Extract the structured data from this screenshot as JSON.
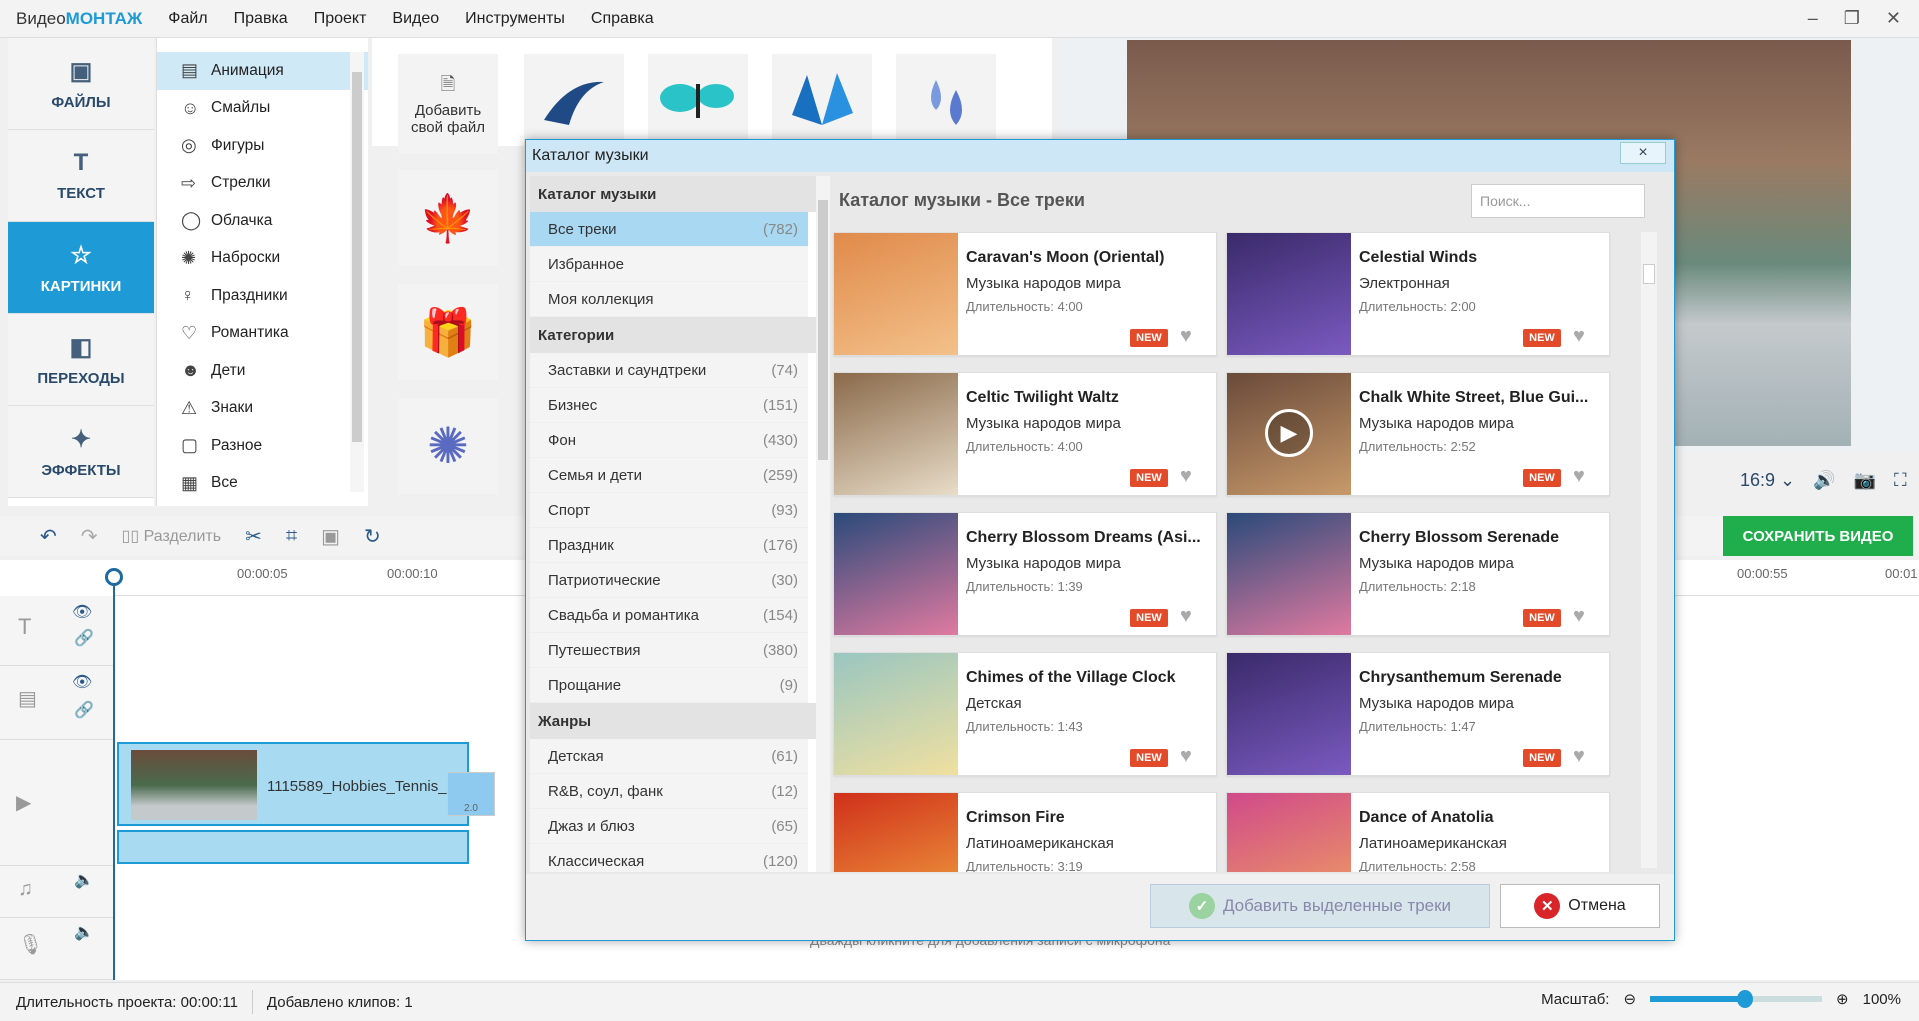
{
  "app": {
    "title_a": "Видео",
    "title_b": "МОНТАЖ"
  },
  "menu": [
    "Файл",
    "Правка",
    "Проект",
    "Видео",
    "Инструменты",
    "Справка"
  ],
  "left_nav": [
    {
      "label": "ФАЙЛЫ",
      "icon": "image-icon"
    },
    {
      "label": "ТЕКСТ",
      "icon": "text-icon"
    },
    {
      "label": "КАРТИНКИ",
      "icon": "star-icon",
      "active": true
    },
    {
      "label": "ПЕРЕХОДЫ",
      "icon": "transitions-icon"
    },
    {
      "label": "ЭФФЕКТЫ",
      "icon": "wand-icon"
    }
  ],
  "categories": [
    "Анимация",
    "Смайлы",
    "Фигуры",
    "Стрелки",
    "Облачка",
    "Наброски",
    "Праздники",
    "Романтика",
    "Дети",
    "Знаки",
    "Разное",
    "Все"
  ],
  "gallery": {
    "add_file": "Добавить свой файл"
  },
  "preview": {
    "aspect": "16:9"
  },
  "toolbar": {
    "split": "Разделить"
  },
  "save_button": "СОХРАНИТЬ ВИДЕО",
  "ruler": [
    "00:00:05",
    "00:00:10",
    "00:00:55",
    "00:01"
  ],
  "clip": {
    "name": "1115589_Hobbies_Tennis_",
    "speed": "2.0"
  },
  "mic_hint": "Дважды кликните для добавления записи с микрофона",
  "status": {
    "duration": "Длительность проекта:  00:00:11",
    "clips": "Добавлено клипов: 1",
    "scale_label": "Масштаб:",
    "zoom": "100%",
    "zoom_value": 0.55
  },
  "dialog": {
    "title": "Каталог музыки",
    "close": "×",
    "heading": "Каталог музыки - Все треки",
    "search_placeholder": "Поиск...",
    "side": {
      "h1": "Каталог музыки",
      "top": [
        {
          "name": "Все треки",
          "count": "(782)",
          "active": true
        },
        {
          "name": "Избранное",
          "count": ""
        },
        {
          "name": "Моя коллекция",
          "count": ""
        }
      ],
      "h2": "Категории",
      "cats": [
        {
          "name": "Заставки и саундтреки",
          "count": "(74)"
        },
        {
          "name": "Бизнес",
          "count": "(151)"
        },
        {
          "name": "Фон",
          "count": "(430)"
        },
        {
          "name": "Семья и дети",
          "count": "(259)"
        },
        {
          "name": "Спорт",
          "count": "(93)"
        },
        {
          "name": "Праздник",
          "count": "(176)"
        },
        {
          "name": "Патриотические",
          "count": "(30)"
        },
        {
          "name": "Свадьба и романтика",
          "count": "(154)"
        },
        {
          "name": "Путешествия",
          "count": "(380)"
        },
        {
          "name": "Прощание",
          "count": "(9)"
        }
      ],
      "h3": "Жанры",
      "genres": [
        {
          "name": "Детская",
          "count": "(61)"
        },
        {
          "name": "R&B, соул, фанк",
          "count": "(12)"
        },
        {
          "name": "Джаз и блюз",
          "count": "(65)"
        },
        {
          "name": "Классическая",
          "count": "(120)"
        }
      ]
    },
    "tracks": [
      {
        "title": "Caravan's Moon (Oriental)",
        "genre": "Музыка народов мира",
        "duration": "Длительность: 4:00",
        "color1": "#e08a4a",
        "color2": "#f3c18a"
      },
      {
        "title": "Celestial Winds",
        "genre": "Электронная",
        "duration": "Длительность: 2:00",
        "color1": "#3a2a6a",
        "color2": "#7a5ac0"
      },
      {
        "title": "Celtic Twilight Waltz",
        "genre": "Музыка народов мира",
        "duration": "Длительность: 4:00",
        "color1": "#8a6a4a",
        "color2": "#e8dcc8"
      },
      {
        "title": "Chalk White Street, Blue Gui...",
        "genre": "Музыка народов мира",
        "duration": "Длительность: 2:52",
        "color1": "#6a4a3a",
        "color2": "#c89a6a"
      },
      {
        "title": "Cherry Blossom Dreams (Asi...",
        "genre": "Музыка народов мира",
        "duration": "Длительность: 1:39",
        "color1": "#2a4a7a",
        "color2": "#e07aa0"
      },
      {
        "title": "Cherry Blossom Serenade",
        "genre": "Музыка народов мира",
        "duration": "Длительность: 2:18",
        "color1": "#2a4a7a",
        "color2": "#e07aa0"
      },
      {
        "title": "Chimes of the Village Clock",
        "genre": "Детская",
        "duration": "Длительность: 1:43",
        "color1": "#9ac6c0",
        "color2": "#f0e0a0"
      },
      {
        "title": "Chrysanthemum Serenade",
        "genre": "Музыка народов мира",
        "duration": "Длительность: 1:47",
        "color1": "#3a2a6a",
        "color2": "#7a5ac0"
      },
      {
        "title": "Crimson Fire",
        "genre": "Латиноамериканская",
        "duration": "Длительность: 3:19",
        "color1": "#d0301a",
        "color2": "#f0a040"
      },
      {
        "title": "Dance of Anatolia",
        "genre": "Латиноамериканская",
        "duration": "Длительность: 2:58",
        "color1": "#d04a8a",
        "color2": "#f0a060"
      }
    ],
    "new_badge": "NEW",
    "add_button": "Добавить выделенные треки",
    "cancel_button": "Отмена"
  }
}
